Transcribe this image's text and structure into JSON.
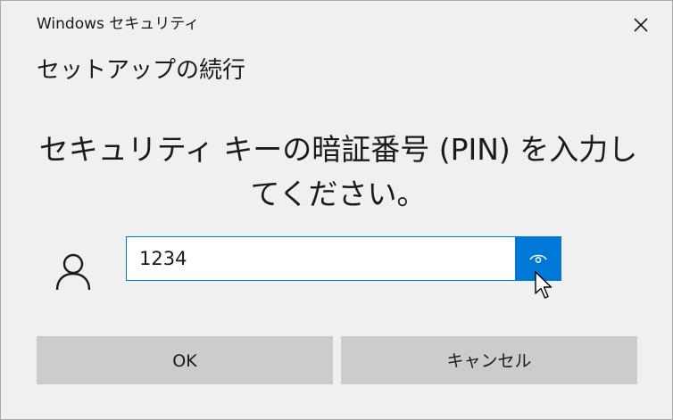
{
  "window": {
    "title": "Windows セキュリティ",
    "close_icon": "close-icon"
  },
  "dialog": {
    "heading": "セットアップの続行",
    "prompt": "セキュリティ キーの暗証番号 (PIN) を入力してください。"
  },
  "pin": {
    "value": "1234",
    "reveal_icon": "eye-icon",
    "user_icon": "user-icon"
  },
  "buttons": {
    "ok_label": "OK",
    "cancel_label": "キャンセル"
  },
  "colors": {
    "accent": "#0078d7",
    "background": "#f0f0f0",
    "button": "#cccccc"
  }
}
